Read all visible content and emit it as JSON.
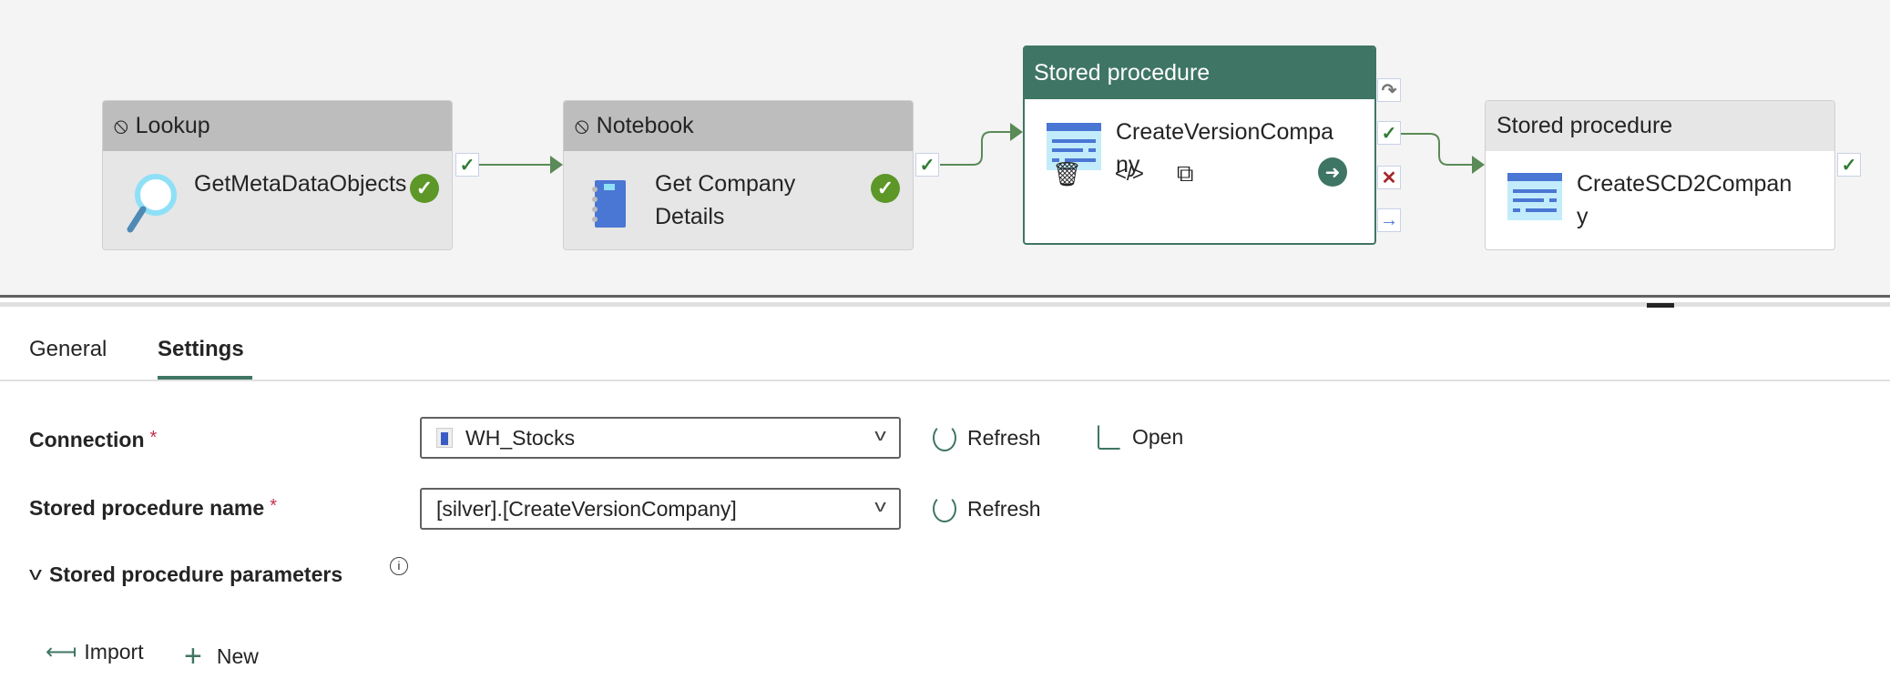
{
  "pipeline": {
    "nodes": [
      {
        "type": "Lookup",
        "name": "GetMetaDataObjects",
        "status": "succeeded"
      },
      {
        "type": "Notebook",
        "name": "Get Company Details",
        "status": "succeeded"
      },
      {
        "type": "Stored procedure",
        "name": "CreateVersionCompany",
        "selected": true
      },
      {
        "type": "Stored procedure",
        "name": "CreateSCD2Company"
      }
    ]
  },
  "tabs": {
    "general": "General",
    "settings": "Settings",
    "active": "Settings"
  },
  "settings": {
    "connection_label": "Connection",
    "required_mark": "*",
    "connection_value": "WH_Stocks",
    "refresh_label": "Refresh",
    "open_label": "Open",
    "sp_name_label": "Stored procedure name",
    "sp_name_value": "[silver].[CreateVersionCompany]",
    "params_label": "Stored procedure parameters",
    "import_label": "Import",
    "new_label": "New"
  },
  "colors": {
    "accent": "#3f7564",
    "success": "#5c9728",
    "error": "#c4314b"
  }
}
